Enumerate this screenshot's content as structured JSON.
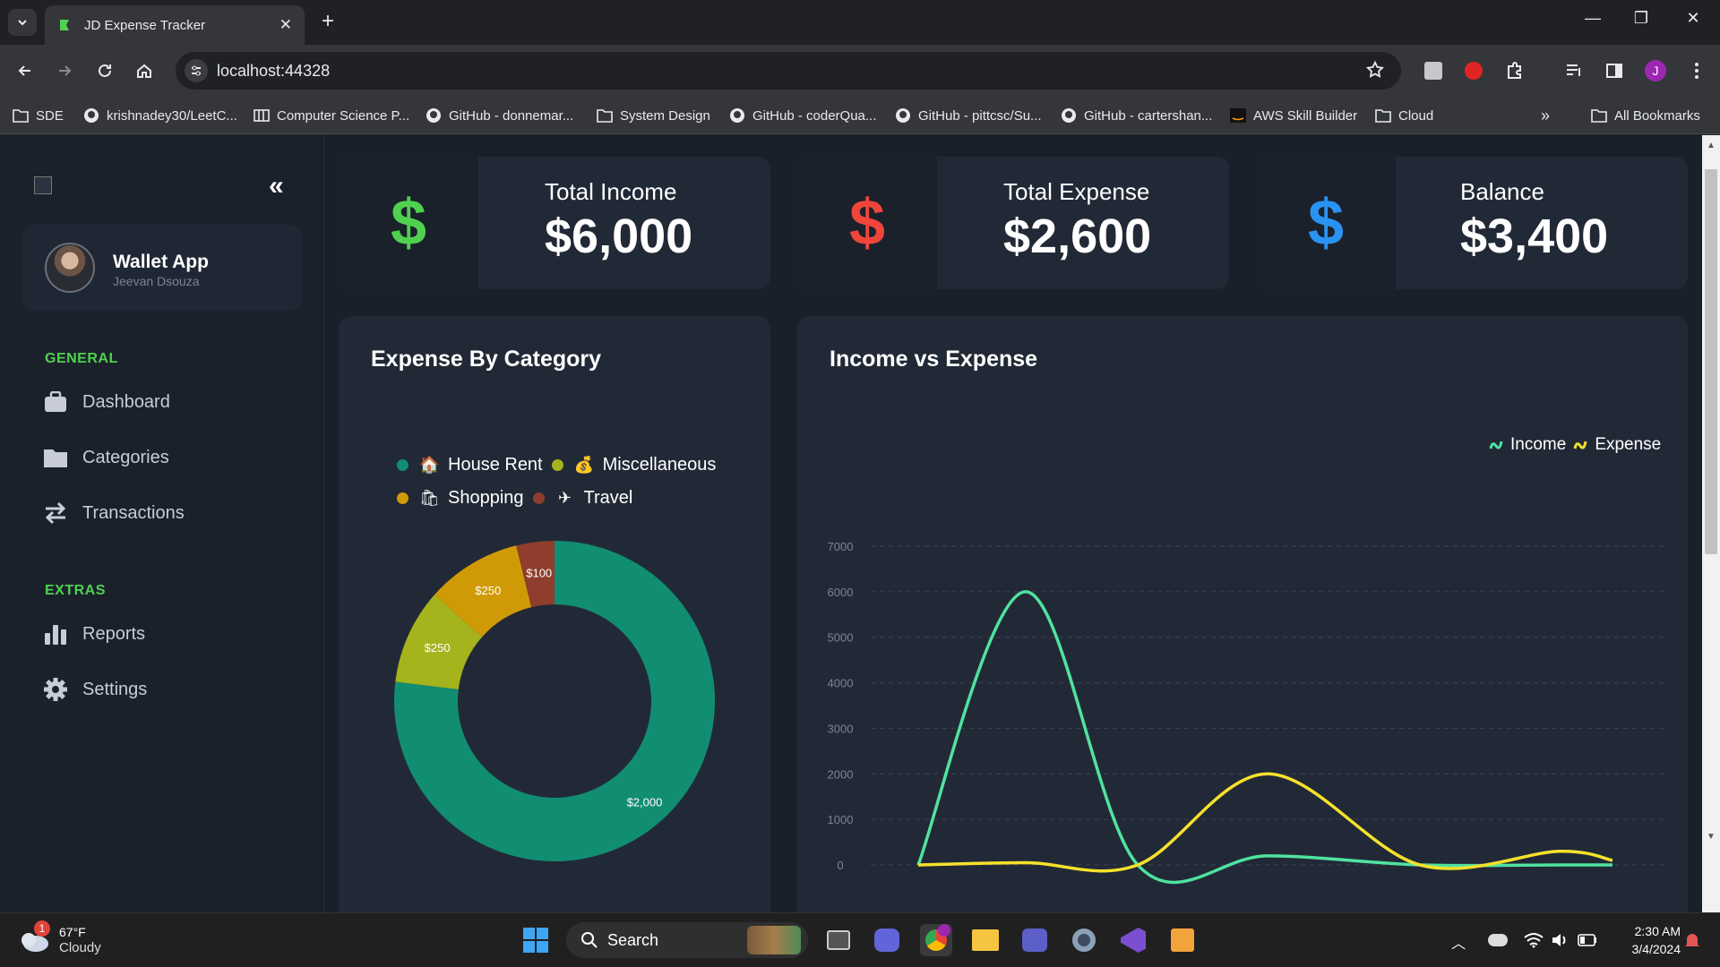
{
  "browser": {
    "tab_title": "JD Expense Tracker",
    "url": "localhost:44328",
    "bookmarks": [
      "SDE",
      "krishnadey30/LeetC...",
      "Computer Science P...",
      "GitHub - donnemar...",
      "System Design",
      "GitHub - coderQua...",
      "GitHub - pittcsc/Su...",
      "GitHub - cartershan...",
      "AWS Skill Builder",
      "Cloud"
    ],
    "all_bookmarks": "All Bookmarks",
    "profile_initial": "J"
  },
  "sidebar": {
    "collapse_label": "«",
    "profile": {
      "name": "Wallet App",
      "sub": "Jeevan Dsouza"
    },
    "general_label": "GENERAL",
    "extras_label": "EXTRAS",
    "general_items": [
      "Dashboard",
      "Categories",
      "Transactions"
    ],
    "extras_items": [
      "Reports",
      "Settings"
    ]
  },
  "stats": [
    {
      "label": "Total Income",
      "value": "$6,000",
      "icon": "$",
      "color": "#4fd14f"
    },
    {
      "label": "Total Expense",
      "value": "$2,600",
      "icon": "$",
      "color": "#f0453a"
    },
    {
      "label": "Balance",
      "value": "$3,400",
      "icon": "$",
      "color": "#2a93f2"
    }
  ],
  "expense_card": {
    "title": "Expense By Category",
    "legend": [
      {
        "emoji": "🏠",
        "label": "House Rent",
        "color": "#118d72"
      },
      {
        "emoji": "💰",
        "label": "Miscellaneous",
        "color": "#a5b31c"
      },
      {
        "emoji": "🛍",
        "label": "Shopping",
        "color": "#d09a06"
      },
      {
        "emoji": "✈",
        "label": "Travel",
        "color": "#8f3d2d"
      }
    ]
  },
  "income_card": {
    "title": "Income vs Expense",
    "legend_income": "Income",
    "legend_expense": "Expense"
  },
  "chart_data": [
    {
      "type": "pie",
      "labels": [
        "House Rent",
        "Miscellaneous",
        "Shopping",
        "Travel"
      ],
      "values": [
        2000,
        250,
        250,
        100
      ],
      "data_labels": [
        "$2,000",
        "$250",
        "$250",
        "$100"
      ],
      "colors": [
        "#118d72",
        "#a5b31c",
        "#d09a06",
        "#8f3d2d"
      ],
      "donut": true
    },
    {
      "type": "line",
      "x": [
        0,
        1,
        2,
        3,
        4,
        5,
        6
      ],
      "series": [
        {
          "name": "Income",
          "color": "#4fe3a0",
          "values": [
            0,
            6000,
            0,
            200,
            0,
            0,
            0
          ]
        },
        {
          "name": "Expense",
          "color": "#f5e12b",
          "values": [
            0,
            50,
            0,
            2000,
            0,
            300,
            100
          ]
        }
      ],
      "ylim": [
        0,
        7000
      ],
      "yticks": [
        0,
        1000,
        2000,
        3000,
        4000,
        5000,
        6000,
        7000
      ],
      "grid": true,
      "legend": "top-right"
    }
  ],
  "system": {
    "temp": "67°F",
    "weather": "Cloudy",
    "weather_badge": "1",
    "search": "Search",
    "time": "2:30 AM",
    "date": "3/4/2024"
  }
}
